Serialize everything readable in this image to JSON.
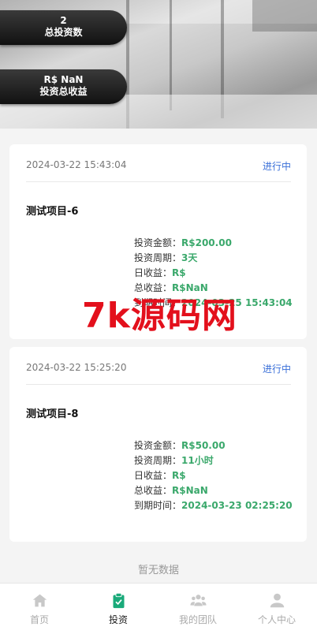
{
  "hero": {
    "total_investments_value": "2",
    "total_investments_label": "总投资数",
    "total_income_value": "R$ NaN",
    "total_income_label": "投资总收益"
  },
  "investments": [
    {
      "date": "2024-03-22 15:43:04",
      "status": "进行中",
      "title": "测试项目-6",
      "amount_label": "投资金额：",
      "amount": "R$200.00",
      "period_label": "投资周期：",
      "period": "3天",
      "daily_label": "日收益：",
      "daily": "R$",
      "total_label": "总收益：",
      "total": "R$NaN",
      "expire_label": "到期时间：",
      "expire": "2024-03-25 15:43:04"
    },
    {
      "date": "2024-03-22 15:25:20",
      "status": "进行中",
      "title": "测试项目-8",
      "amount_label": "投资金额：",
      "amount": "R$50.00",
      "period_label": "投资周期：",
      "period": "11小时",
      "daily_label": "日收益：",
      "daily": "R$",
      "total_label": "总收益：",
      "total": "R$NaN",
      "expire_label": "到期时间：",
      "expire": "2024-03-23 02:25:20"
    }
  ],
  "empty_text": "暂无数据",
  "watermark": "7k源码网",
  "tabbar": {
    "tabs": [
      {
        "label": "首页",
        "icon": "home-icon"
      },
      {
        "label": "投资",
        "icon": "clipboard-check-icon"
      },
      {
        "label": "我的团队",
        "icon": "team-icon"
      },
      {
        "label": "个人中心",
        "icon": "user-icon"
      }
    ],
    "active_index": 1
  },
  "colors": {
    "accent_green": "#3aa86b",
    "status_blue": "#3a6fd8",
    "active_tab_icon": "#1aaa7a",
    "watermark_red": "#e3101c"
  }
}
